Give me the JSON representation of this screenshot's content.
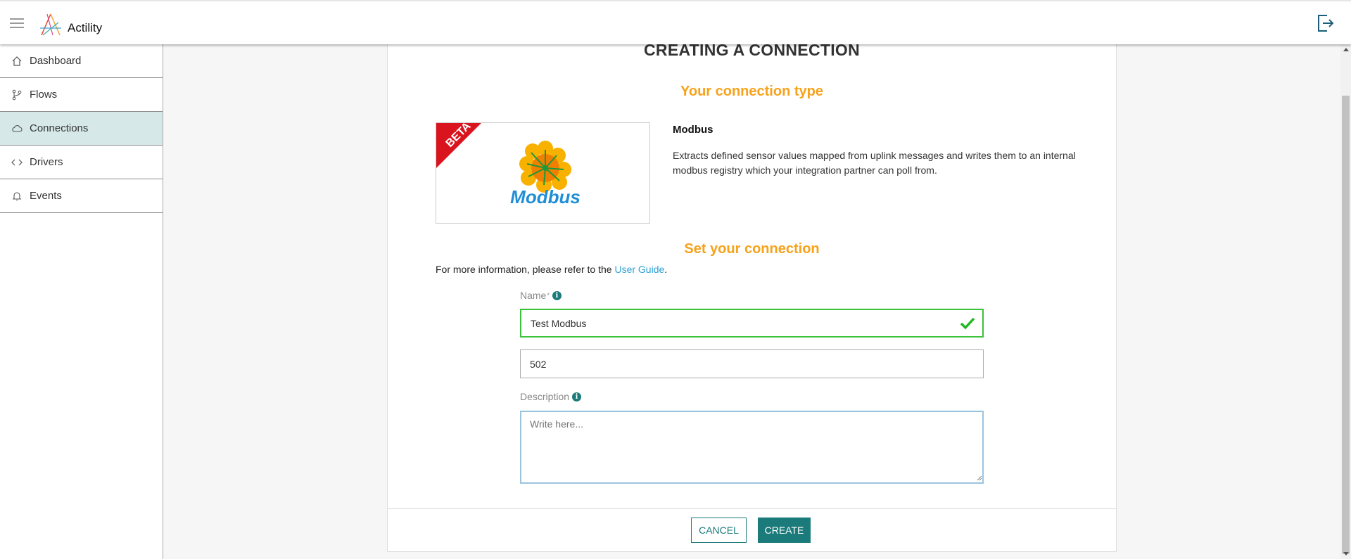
{
  "header": {
    "brand": "Actility",
    "menu_icon": "hamburger-menu-icon",
    "logout_icon": "logout-icon"
  },
  "sidebar": {
    "items": [
      {
        "label": "Dashboard",
        "icon": "home-icon",
        "active": false
      },
      {
        "label": "Flows",
        "icon": "branch-icon",
        "active": false
      },
      {
        "label": "Connections",
        "icon": "cloud-icon",
        "active": true
      },
      {
        "label": "Drivers",
        "icon": "code-icon",
        "active": false
      },
      {
        "label": "Events",
        "icon": "bell-icon",
        "active": false
      }
    ]
  },
  "main": {
    "title": "CREATING A CONNECTION",
    "connection_type_heading": "Your connection type",
    "connection": {
      "badge": "BETA",
      "logo_text": "Modbus",
      "name": "Modbus",
      "description": "Extracts defined sensor values mapped from uplink messages and writes them to an internal modbus registry which your integration partner can poll from."
    },
    "set_connection_heading": "Set your connection",
    "info_prefix": "For more information, please refer to the",
    "info_link": "User Guide",
    "info_suffix": ".",
    "form": {
      "name_label": "Name",
      "name_required_mark": "*",
      "name_value": "Test Modbus",
      "port_value": "502",
      "description_label": "Description",
      "description_placeholder": "Write here..."
    },
    "buttons": {
      "cancel": "CANCEL",
      "create": "CREATE"
    }
  },
  "colors": {
    "accent": "#1b7a7a",
    "section_heading": "#f7a21b",
    "active_nav": "#d6e8e8",
    "valid": "#3bc23b",
    "link": "#2a9fd6"
  }
}
